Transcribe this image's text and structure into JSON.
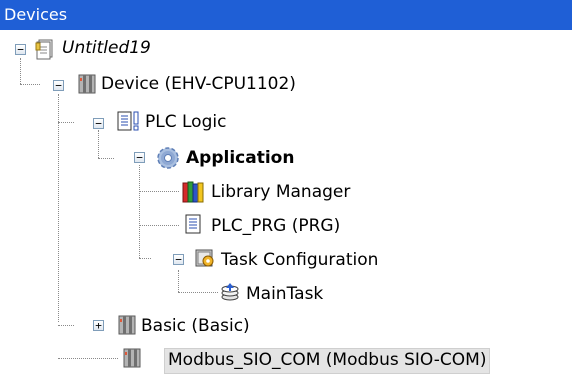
{
  "panel": {
    "title": "Devices"
  },
  "tree": {
    "project": {
      "label": "Untitled19",
      "icon": "project-file-icon"
    },
    "device": {
      "label": "Device (EHV-CPU1102)",
      "icon": "device-module-icon"
    },
    "plc_logic": {
      "label": "PLC Logic",
      "icon": "plc-logic-icon"
    },
    "application": {
      "label": "Application",
      "icon": "gear-icon"
    },
    "library_manager": {
      "label": "Library Manager",
      "icon": "library-books-icon"
    },
    "plc_prg": {
      "label": "PLC_PRG (PRG)",
      "icon": "program-document-icon"
    },
    "task_configuration": {
      "label": "Task Configuration",
      "icon": "task-configuration-icon"
    },
    "main_task": {
      "label": "MainTask",
      "icon": "task-icon"
    },
    "basic": {
      "label": "Basic (Basic)",
      "icon": "device-module-icon"
    },
    "modbus": {
      "label": "Modbus_SIO_COM (Modbus SIO-COM)",
      "icon": "device-module-icon",
      "selected": true
    }
  },
  "expanders": {
    "expanded": "−",
    "collapsed": "+"
  },
  "colors": {
    "header_bg": "#1f5fd6",
    "selection_bg": "#e4e4e4"
  }
}
